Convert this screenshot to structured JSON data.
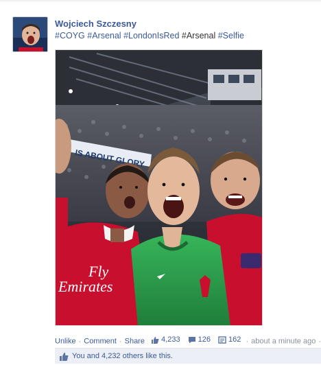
{
  "post": {
    "author": "Wojciech Szczesny",
    "hashtags": [
      "#COYG",
      "#Arsenal",
      "#LondonIsRed",
      "#Arsenal",
      "#Selfie"
    ],
    "photo": {
      "banner_text": "IS ABOUT GLORY",
      "shirt_text_1": "Fly",
      "shirt_text_2": "Emirates"
    }
  },
  "actions": {
    "unlike": "Unlike",
    "comment": "Comment",
    "share": "Share",
    "likes_count": "4,233",
    "comments_count": "126",
    "shares_count": "162",
    "timestamp": "about a minute ago"
  },
  "likes_summary": {
    "text": "You and 4,232 others like this."
  },
  "icons": {
    "like": "thumbs-up-icon",
    "comment": "comment-bubble-icon",
    "share": "share-icon",
    "privacy": "globe-icon"
  },
  "colors": {
    "link": "#3b5998",
    "muted": "#898f9c",
    "likes_bar_bg": "#eceff5",
    "arsenal_red": "#c8102e",
    "keeper_green": "#2fa84f"
  }
}
